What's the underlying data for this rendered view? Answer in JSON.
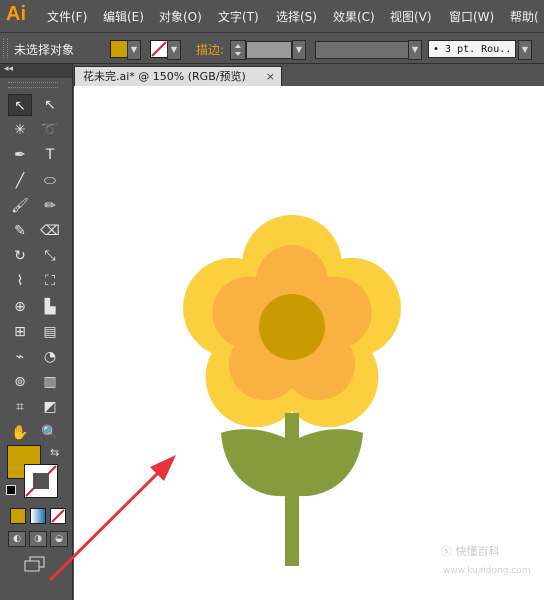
{
  "app": {
    "logo": "Ai"
  },
  "menu": [
    "文件(F)",
    "编辑(E)",
    "对象(O)",
    "文字(T)",
    "选择(S)",
    "效果(C)",
    "视图(V)",
    "窗口(W)",
    "帮助("
  ],
  "control_bar": {
    "selection_label": "未选择对象",
    "fill_color": "#c9a000",
    "stroke_label": "描边:",
    "brush_value": "• 3 pt. Rou.."
  },
  "toolbar": {
    "collapse_label": "◂◂",
    "tools": [
      {
        "name": "selection-tool-icon",
        "glyph": "↖"
      },
      {
        "name": "direct-selection-tool-icon",
        "glyph": "↖"
      },
      {
        "name": "magic-wand-tool-icon",
        "glyph": "✳"
      },
      {
        "name": "lasso-tool-icon",
        "glyph": "➰"
      },
      {
        "name": "pen-tool-icon",
        "glyph": "✒"
      },
      {
        "name": "type-tool-icon",
        "glyph": "T"
      },
      {
        "name": "line-tool-icon",
        "glyph": "╱"
      },
      {
        "name": "ellipse-tool-icon",
        "glyph": "⬭"
      },
      {
        "name": "paintbrush-tool-icon",
        "glyph": "🖌"
      },
      {
        "name": "pencil-tool-icon",
        "glyph": "✏"
      },
      {
        "name": "blob-brush-tool-icon",
        "glyph": "✎"
      },
      {
        "name": "eraser-tool-icon",
        "glyph": "⌫"
      },
      {
        "name": "rotate-tool-icon",
        "glyph": "↻"
      },
      {
        "name": "scale-tool-icon",
        "glyph": "⤡"
      },
      {
        "name": "warp-tool-icon",
        "glyph": "⌇"
      },
      {
        "name": "free-transform-tool-icon",
        "glyph": "⛶"
      },
      {
        "name": "shape-builder-tool-icon",
        "glyph": "⊕"
      },
      {
        "name": "perspective-grid-tool-icon",
        "glyph": "▙"
      },
      {
        "name": "mesh-tool-icon",
        "glyph": "⊞"
      },
      {
        "name": "gradient-tool-icon",
        "glyph": "▤"
      },
      {
        "name": "eyedropper-tool-icon",
        "glyph": "⌁"
      },
      {
        "name": "blend-tool-icon",
        "glyph": "◔"
      },
      {
        "name": "symbol-sprayer-tool-icon",
        "glyph": "⊚"
      },
      {
        "name": "column-graph-tool-icon",
        "glyph": "▥"
      },
      {
        "name": "artboard-tool-icon",
        "glyph": "⌗"
      },
      {
        "name": "slice-tool-icon",
        "glyph": "◩"
      },
      {
        "name": "hand-tool-icon",
        "glyph": "✋"
      },
      {
        "name": "zoom-tool-icon",
        "glyph": "🔍"
      }
    ],
    "fill_color": "#c9a000"
  },
  "document": {
    "tab_title": "花未完.ai* @ 150% (RGB/预览)",
    "close_glyph": "×"
  },
  "artwork": {
    "outer_petal_color": "#fccf3e",
    "inner_petal_color": "#f9b242",
    "center_color": "#c99a02",
    "stem_color": "#859c3c"
  },
  "annotation": {
    "arrow_color": "#e8333a"
  },
  "watermark": {
    "text": "ⓢ 快懂百科",
    "subtext": "www.kuaidong.com"
  }
}
